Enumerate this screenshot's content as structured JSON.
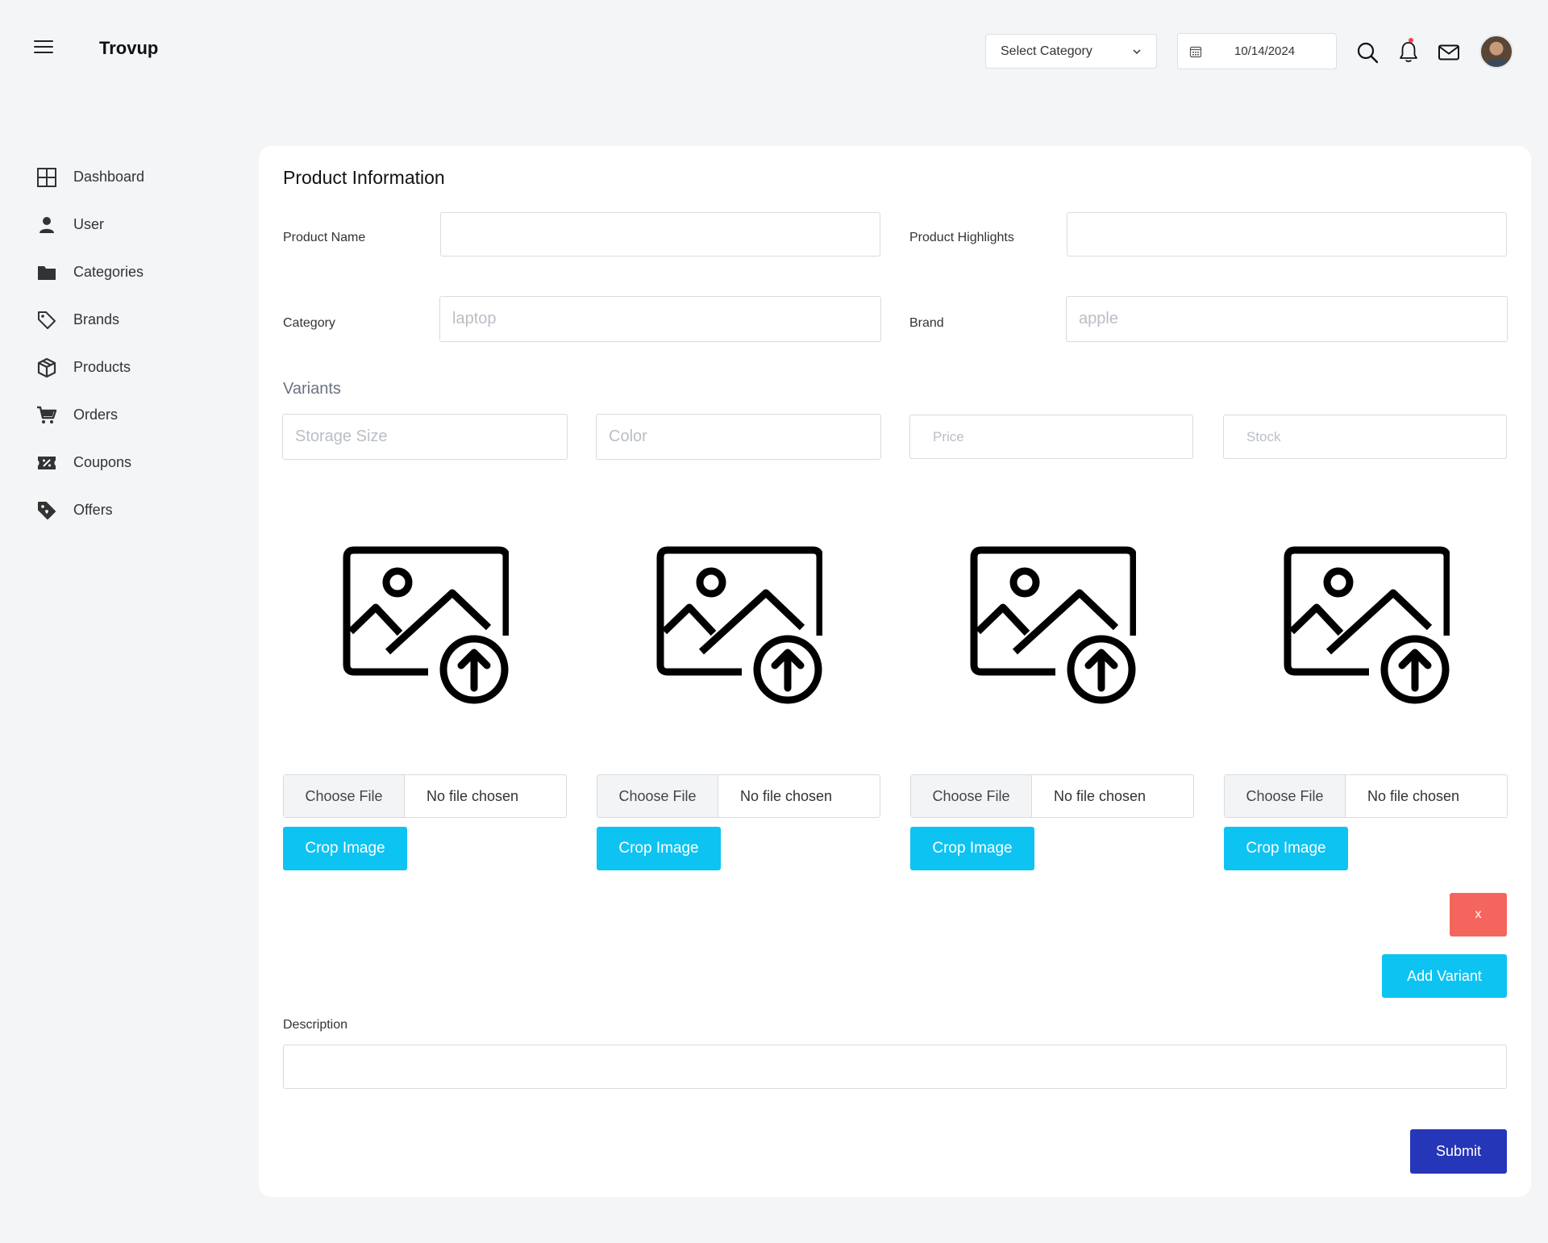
{
  "header": {
    "brand": "Trovup",
    "category_select": "Select Category",
    "date": "10/14/2024"
  },
  "sidebar": {
    "items": [
      {
        "label": "Dashboard",
        "icon": "grid-icon"
      },
      {
        "label": "User",
        "icon": "user-icon"
      },
      {
        "label": "Categories",
        "icon": "folder-icon"
      },
      {
        "label": "Brands",
        "icon": "tag-icon"
      },
      {
        "label": "Products",
        "icon": "box-icon"
      },
      {
        "label": "Orders",
        "icon": "cart-icon"
      },
      {
        "label": "Coupons",
        "icon": "coupon-icon"
      },
      {
        "label": "Offers",
        "icon": "offer-tag-icon"
      }
    ]
  },
  "form": {
    "title": "Product Information",
    "product_name_label": "Product Name",
    "product_highlights_label": "Product Highlights",
    "category_label": "Category",
    "category_placeholder": "laptop",
    "brand_label": "Brand",
    "brand_placeholder": "apple",
    "variants_title": "Variants",
    "variant_fields": {
      "storage": "Storage Size",
      "color": "Color",
      "price": "Price",
      "stock": "Stock"
    },
    "uploads": [
      {
        "choose": "Choose File",
        "status": "No file chosen",
        "crop": "Crop Image"
      },
      {
        "choose": "Choose File",
        "status": "No file chosen",
        "crop": "Crop Image"
      },
      {
        "choose": "Choose File",
        "status": "No file chosen",
        "crop": "Crop Image"
      },
      {
        "choose": "Choose File",
        "status": "No file chosen",
        "crop": "Crop Image"
      }
    ],
    "remove_variant": "x",
    "add_variant": "Add Variant",
    "description_label": "Description",
    "submit": "Submit"
  },
  "colors": {
    "accent": "#0dc3f2",
    "submit": "#2636b8",
    "danger": "#f4665d"
  }
}
